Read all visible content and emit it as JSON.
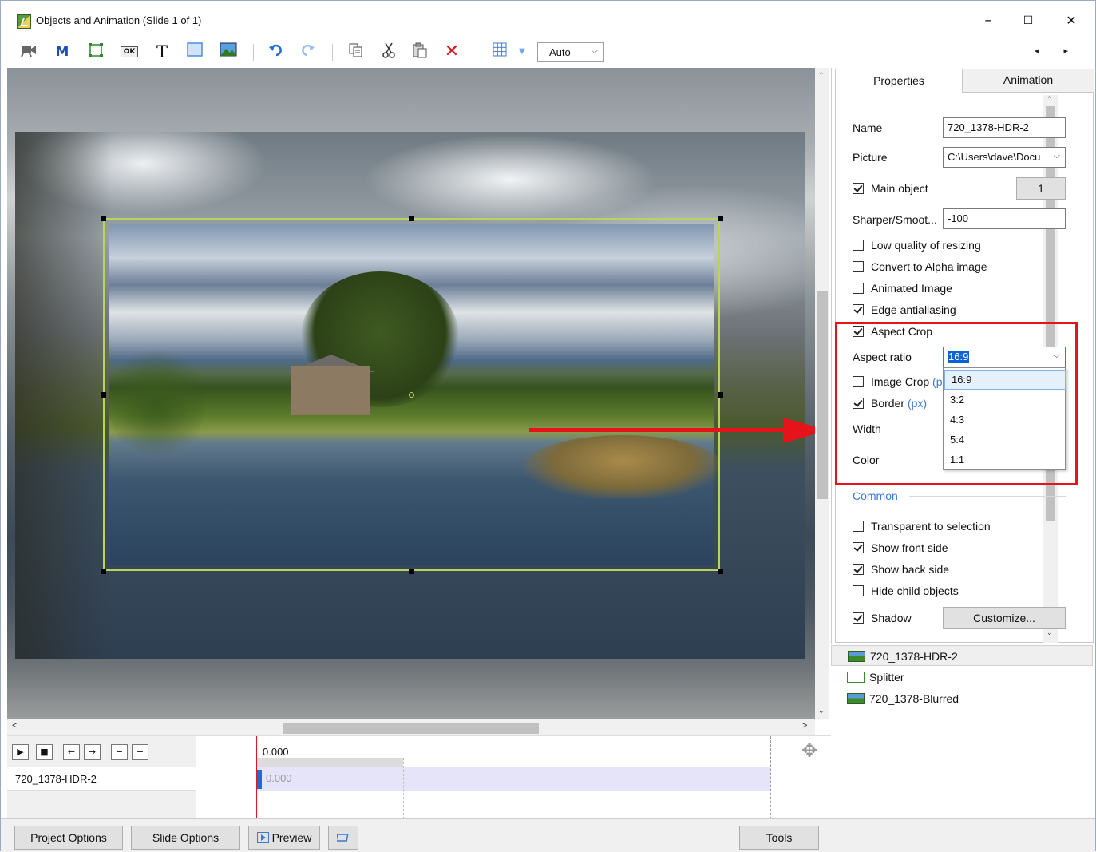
{
  "window": {
    "title": "Objects and Animation (Slide 1 of 1)",
    "controls": {
      "minimize": "–",
      "maximize": "☐",
      "close": "✕"
    }
  },
  "toolbar": {
    "icons": [
      "camera-icon",
      "mask-icon",
      "frame-icon",
      "button-icon",
      "text-icon",
      "rectangle-icon",
      "image-icon",
      "undo-icon",
      "redo-icon",
      "copy-icon",
      "cut-icon",
      "paste-icon",
      "delete-icon",
      "grid-icon"
    ],
    "glyphs": {
      "mask": "M",
      "text": "T",
      "button": "OK",
      "delete": "✕"
    },
    "zoom_value": "Auto",
    "nav": "◂ ▸"
  },
  "canvas": {
    "selected_object": "720_1378-HDR-2"
  },
  "timeline": {
    "controls": [
      "▶",
      "■",
      "←",
      "→",
      "−",
      "+"
    ],
    "current_time": "0.000",
    "row_label": "720_1378-HDR-2",
    "track_time": "0.000"
  },
  "bottom": {
    "project_options": "Project Options",
    "slide_options": "Slide Options",
    "preview": "Preview",
    "tools": "Tools"
  },
  "panel": {
    "tabs": {
      "properties": "Properties",
      "animation": "Animation"
    },
    "name_label": "Name",
    "name_value": "720_1378-HDR-2",
    "picture_label": "Picture",
    "picture_value": "C:\\Users\\dave\\Docu",
    "main_object_label": "Main object",
    "main_object_value": "1",
    "sharper_label": "Sharper/Smoot...",
    "sharper_value": "-100",
    "low_quality_label": "Low quality of resizing",
    "alpha_label": "Convert to Alpha image",
    "animated_label": "Animated Image",
    "edge_label": "Edge antialiasing",
    "aspect_crop_label": "Aspect Crop",
    "aspect_ratio_label": "Aspect ratio",
    "aspect_ratio_value": "16:9",
    "image_crop_label": "Image Crop",
    "image_crop_hint": "(p",
    "border_label": "Border",
    "border_unit": "(px)",
    "width_label": "Width",
    "color_label": "Color",
    "aspect_options": [
      "16:9",
      "3:2",
      "4:3",
      "5:4",
      "1:1"
    ],
    "common_label": "Common",
    "transparent_label": "Transparent to selection",
    "front_label": "Show front side",
    "back_label": "Show back side",
    "hide_child_label": "Hide child objects",
    "shadow_label": "Shadow",
    "customize_label": "Customize...",
    "checks": {
      "main_object": true,
      "low_quality": false,
      "alpha": false,
      "animated": false,
      "edge": true,
      "aspect_crop": true,
      "image_crop": false,
      "border": true,
      "transparent": false,
      "front": true,
      "back": true,
      "hide_child": false,
      "shadow": true
    }
  },
  "objects": [
    {
      "name": "720_1378-HDR-2",
      "icon": "image-icon"
    },
    {
      "name": "Splitter",
      "icon": "frame-icon"
    },
    {
      "name": "720_1378-Blurred",
      "icon": "image-icon"
    }
  ],
  "colors": {
    "accent_red": "#e6141a",
    "selection_green": "#b7d45b",
    "link_blue": "#3a79d0"
  }
}
